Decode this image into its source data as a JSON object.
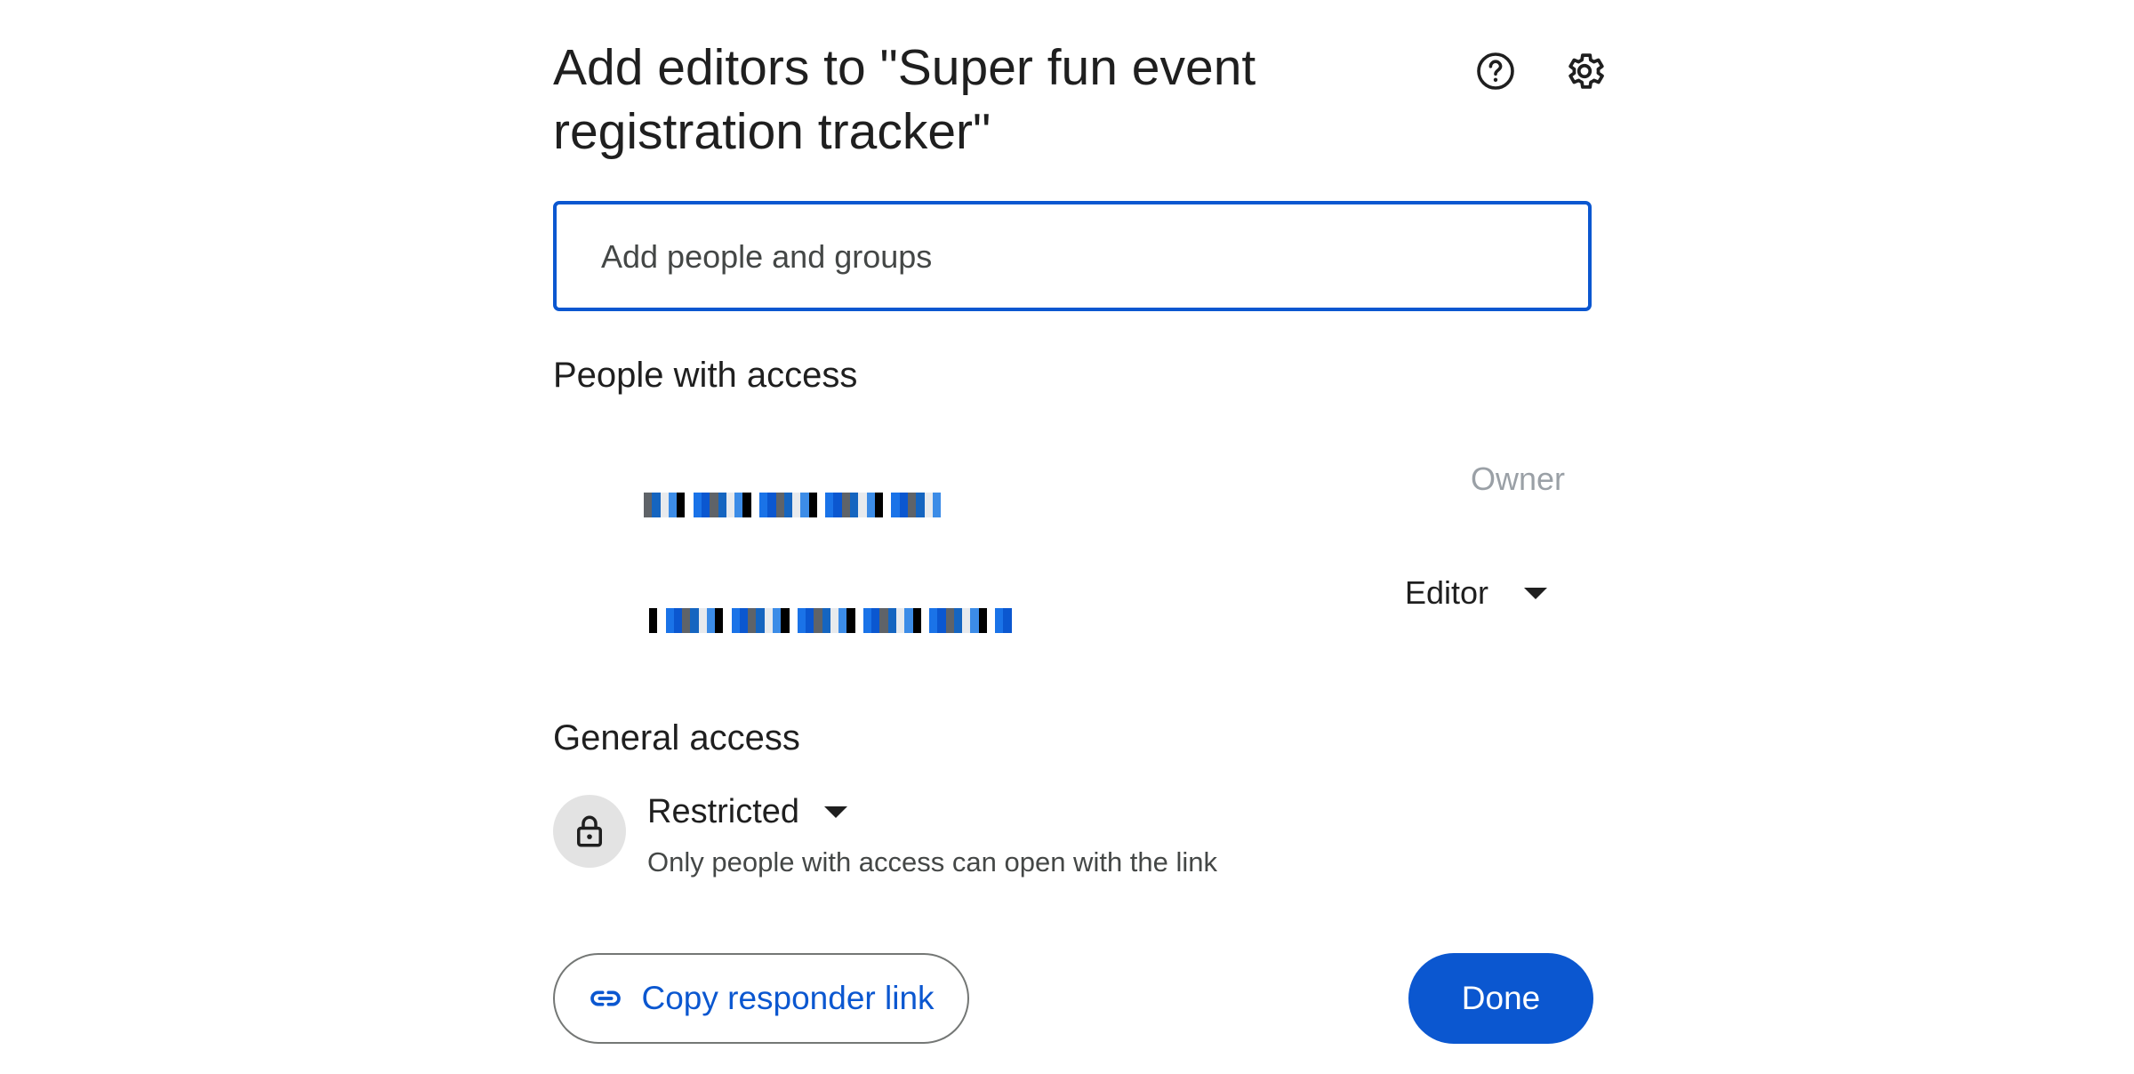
{
  "dialog": {
    "title": "Add editors to \"Super fun event registration tracker\"",
    "icons": [
      "help-icon",
      "settings-icon"
    ]
  },
  "search": {
    "placeholder": "Add people and groups",
    "value": ""
  },
  "people_with_access": {
    "heading": "People with access",
    "people": [
      {
        "name_redacted": true,
        "role": "Owner"
      },
      {
        "name_redacted": true,
        "role": "Editor"
      }
    ]
  },
  "general_access": {
    "heading": "General access",
    "setting": "Restricted",
    "description": "Only people with access can open with the link",
    "icon": "lock-icon"
  },
  "footer": {
    "copy_link_label": "Copy responder link",
    "copy_link_icon": "link-icon",
    "done_label": "Done"
  },
  "colors": {
    "accent": "#0b57d0",
    "owner_label": "#9aa0a6",
    "lock_bg": "#e3e3e3"
  }
}
